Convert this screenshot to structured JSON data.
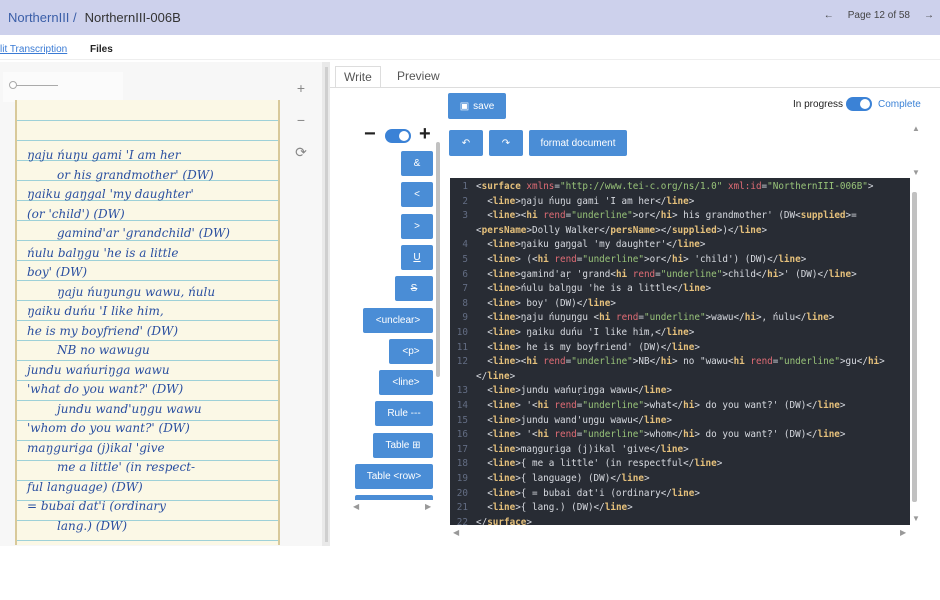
{
  "header": {
    "collection": "NorthernIII /",
    "item": "NorthernIII-006B",
    "prev_icon": "arrow-left-icon",
    "page": "Page 12 of 58",
    "next_icon": "arrow-right-icon"
  },
  "nav_tabs": [
    "lit Transcription",
    "Files"
  ],
  "viewer": {
    "tools": [
      "+",
      "−",
      "⟳"
    ],
    "handwriting": [
      "ŋaju ńuŋu gami 'I am her",
      "or his grandmother' (DW)",
      "ŋaiku gaŋgal 'my daughter'",
      "(or 'child') (DW)",
      "gamind'ar 'grandchild' (DW)",
      "ńulu balŋgu 'he is a little",
      "boy' (DW)",
      "ŋaju ńuŋungu wawu, ńulu",
      "ŋaiku duńu 'I like him,",
      "he is my boyfriend' (DW)",
      "NB no wawugu",
      "jundu wańuriŋga wawu",
      "'what do you want?' (DW)",
      "jundu wand'uŋgu wawu",
      "'whom do you want?' (DW)",
      "maŋguriga (j)ikal 'give",
      "me a little' (in respect-",
      "ful language) (DW)",
      "= bubai dat'i (ordinary",
      "lang.) (DW)"
    ]
  },
  "editor_tabs": [
    "Write",
    "Preview"
  ],
  "toolbar": {
    "save": "save",
    "format": "format document",
    "undo_icon": "undo-icon",
    "redo_icon": "redo-icon",
    "status_left": "In progress",
    "status_right": "Complete",
    "complete": true,
    "font_minus": "−",
    "font_plus": "+"
  },
  "insert_buttons": [
    "&",
    "<",
    ">",
    "U",
    "S",
    "<unclear>",
    "<p>",
    "<line>",
    "Rule ---",
    "Table ⊞",
    "Table <row>"
  ],
  "code_lines": [
    "<surface xmlns=\"http://www.tei-c.org/ns/1.0\" xml:id=\"NorthernIII-006B\">",
    "  <line>ŋaju ńuŋu gami 'I am her</line>",
    "  <line><hi rend=\"underline\">or</hi> his grandmother' (DW<supplied>=",
    "<persName>Dolly Walker</persName></supplied>)</line>",
    "  <line>ŋaiku gaŋgal 'my daughter'</line>",
    "  <line> (<hi rend=\"underline\">or</hi> 'child') (DW)</line>",
    "  <line>gamind'aṛ 'grand<hi rend=\"underline\">child</hi>' (DW)</line>",
    "  <line>ńulu balŋgu 'he is a little</line>",
    "  <line> boy' (DW)</line>",
    "  <line>ŋaju ńuŋuŋgu <hi rend=\"underline\">wawu</hi>, ńulu</line>",
    "  <line> ŋaiku duńu 'I like him,</line>",
    "  <line> he is my boyfriend' (DW)</line>",
    "  <line><hi rend=\"underline\">NB</hi> no \"wawu<hi rend=\"underline\">gu</hi>",
    "</line>",
    "  <line>jundu wańuṛiŋga wawu</line>",
    "  <line> '<hi rend=\"underline\">what</hi> do you want?' (DW)</line>",
    "  <line>jundu wand'uŋgu wawu</line>",
    "  <line> '<hi rend=\"underline\">whom</hi> do you want?' (DW)</line>",
    "  <line>maŋguṛiga (j)ikal 'give</line>",
    "  <line>{ me a little' (in respectful</line>",
    "  <line>{ language) (DW)</line>",
    "  <line>{ = bubai dat'i (ordinary</line>",
    "  <line>{ lang.) (DW)</line>",
    "</surface>"
  ],
  "line_numbers": [
    "1",
    "2",
    "3",
    "",
    "4",
    "5",
    "6",
    "7",
    "8",
    "9",
    "10",
    "11",
    "12",
    "",
    "13",
    "14",
    "15",
    "16",
    "17",
    "18",
    "19",
    "20",
    "21",
    "22"
  ],
  "colors": {
    "header_bg": "#cdd1ec",
    "accent": "#4a8dd6",
    "editor_bg": "#282c34"
  }
}
